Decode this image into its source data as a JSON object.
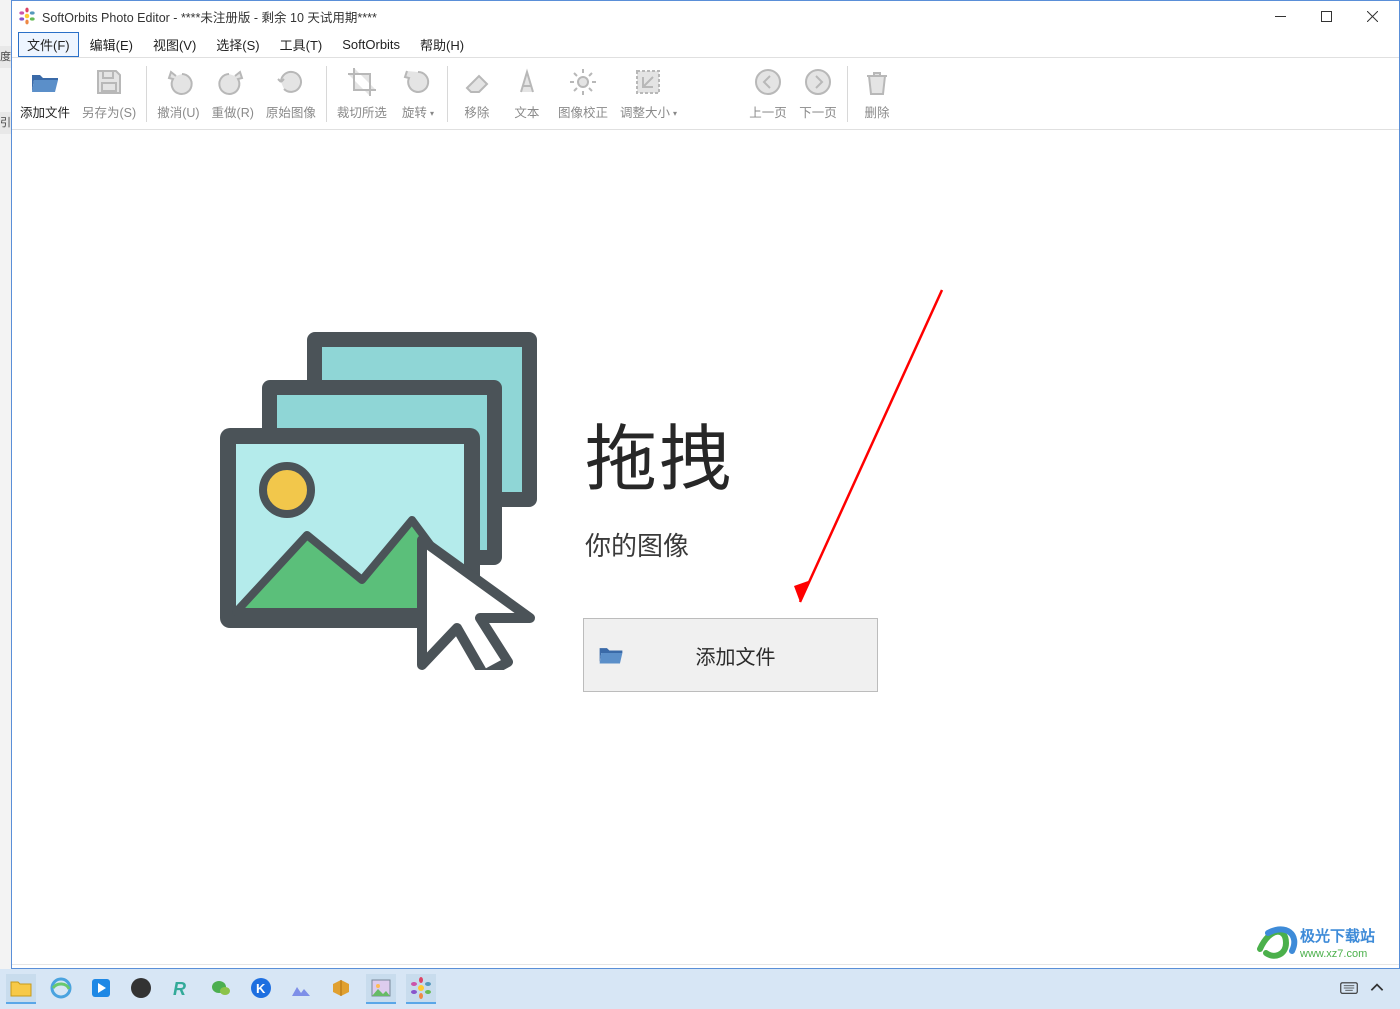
{
  "window": {
    "title": "SoftOrbits Photo Editor - ****未注册版 - 剩余 10 天试用期****"
  },
  "menu": {
    "items": [
      {
        "label": "文件(F)",
        "selected": true
      },
      {
        "label": "编辑(E)"
      },
      {
        "label": "视图(V)"
      },
      {
        "label": "选择(S)"
      },
      {
        "label": "工具(T)"
      },
      {
        "label": "SoftOrbits"
      },
      {
        "label": "帮助(H)"
      }
    ]
  },
  "toolbar": {
    "add_files": "添加文件",
    "save_as": "另存为(S)",
    "undo": "撤消(U)",
    "redo": "重做(R)",
    "original": "原始图像",
    "crop": "裁切所选",
    "rotate": "旋转",
    "move": "移除",
    "text": "文本",
    "correct": "图像校正",
    "resize": "调整大小",
    "prev": "上一页",
    "next": "下一页",
    "delete": "删除"
  },
  "dropzone": {
    "heading": "拖拽",
    "sub": "你的图像",
    "button": "添加文件"
  },
  "watermark": {
    "line1": "极光下载站",
    "line2": "www.xz7.com"
  },
  "left_sliver": {
    "a": "度",
    "b": "引"
  }
}
